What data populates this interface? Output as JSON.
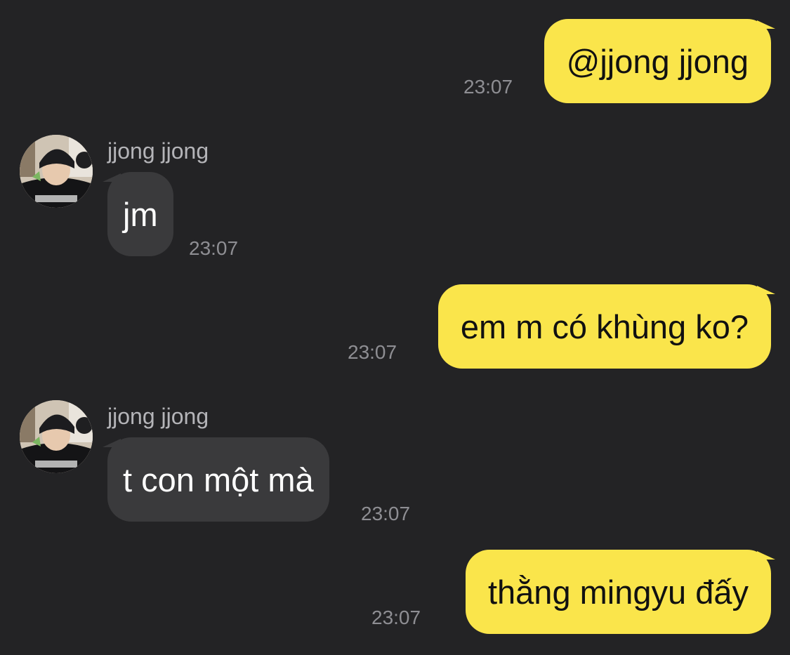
{
  "messages": [
    {
      "direction": "outgoing",
      "text": "@jjong jjong",
      "time": "23:07"
    },
    {
      "direction": "incoming",
      "sender": "jjong jjong",
      "avatar": "profile-photo",
      "text": "jm",
      "time": "23:07"
    },
    {
      "direction": "outgoing",
      "text": "em m có khùng ko?",
      "time": "23:07"
    },
    {
      "direction": "incoming",
      "sender": "jjong jjong",
      "avatar": "profile-photo",
      "text": "t con một mà",
      "time": "23:07"
    },
    {
      "direction": "outgoing",
      "text": "thằng mingyu đấy",
      "time": "23:07"
    }
  ],
  "theme": {
    "background": "#232325",
    "outgoing_bubble": "#fae54b",
    "incoming_bubble": "#3a3a3c",
    "timestamp_color": "#8e8e93"
  }
}
